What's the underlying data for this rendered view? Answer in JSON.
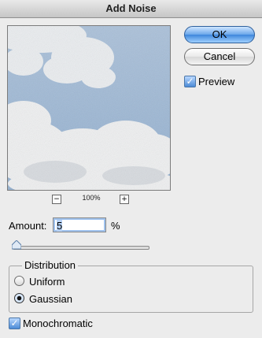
{
  "window": {
    "title": "Add Noise"
  },
  "preview": {
    "zoom_minus": "−",
    "zoom_level": "100%",
    "zoom_plus": "+"
  },
  "buttons": {
    "ok": "OK",
    "cancel": "Cancel"
  },
  "preview_option": {
    "label": "Preview",
    "checked": true
  },
  "amount": {
    "label": "Amount:",
    "value": "5",
    "unit": "%",
    "slider_level": 0.05
  },
  "distribution": {
    "title": "Distribution",
    "options": [
      {
        "label": "Uniform",
        "selected": false
      },
      {
        "label": "Gaussian",
        "selected": true
      }
    ]
  },
  "monochromatic": {
    "label": "Monochromatic",
    "checked": true
  },
  "icons": {
    "check": "✓"
  }
}
